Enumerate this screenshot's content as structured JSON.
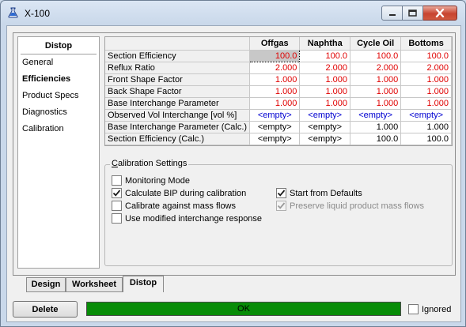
{
  "window": {
    "title": "X-100",
    "app_icon": "flask-icon",
    "controls": [
      "minimize-icon",
      "maximize-icon",
      "close-icon"
    ]
  },
  "nav": {
    "header": "Distop",
    "items": [
      "General",
      "Efficiencies",
      "Product Specs",
      "Diagnostics",
      "Calibration"
    ],
    "active": "Efficiencies"
  },
  "grid": {
    "columns": [
      "Offgas",
      "Naphtha",
      "Cycle Oil",
      "Bottoms"
    ],
    "rows": [
      {
        "label": "Section Efficiency",
        "values": [
          "100.0",
          "100.0",
          "100.0",
          "100.0"
        ],
        "style": "red"
      },
      {
        "label": "Reflux Ratio",
        "values": [
          "2.000",
          "2.000",
          "2.000",
          "2.000"
        ],
        "style": "red"
      },
      {
        "label": "Front Shape Factor",
        "values": [
          "1.000",
          "1.000",
          "1.000",
          "1.000"
        ],
        "style": "red"
      },
      {
        "label": "Back Shape Factor",
        "values": [
          "1.000",
          "1.000",
          "1.000",
          "1.000"
        ],
        "style": "red"
      },
      {
        "label": "Base Interchange Parameter",
        "values": [
          "1.000",
          "1.000",
          "1.000",
          "1.000"
        ],
        "style": "red"
      },
      {
        "label": "Observed Vol Interchange [vol %]",
        "values": [
          "<empty>",
          "<empty>",
          "<empty>",
          "<empty>"
        ],
        "style": "blue"
      },
      {
        "label": "Base Interchange Parameter (Calc.)",
        "values": [
          "<empty>",
          "<empty>",
          "1.000",
          "1.000"
        ],
        "style": "black"
      },
      {
        "label": "Section Efficiency (Calc.)",
        "values": [
          "<empty>",
          "<empty>",
          "100.0",
          "100.0"
        ],
        "style": "black"
      }
    ]
  },
  "calibration": {
    "title_prefix": "",
    "title_accel": "C",
    "title_rest": "alibration Settings",
    "options": {
      "monitoring_mode": {
        "label": "Monitoring Mode",
        "checked": false
      },
      "calculate_bip": {
        "label": "Calculate BIP during calibration",
        "checked": true
      },
      "calibrate_mass": {
        "label": "Calibrate against mass flows",
        "checked": false
      },
      "modified_interchange": {
        "label": "Use modified interchange response",
        "checked": false
      },
      "start_defaults": {
        "label": "Start from Defaults",
        "checked": true
      },
      "preserve_liquid": {
        "label": "Preserve liquid product mass flows",
        "checked": true,
        "disabled": true
      }
    }
  },
  "tabs": {
    "items": [
      "Design",
      "Worksheet",
      "Distop"
    ],
    "active": "Distop"
  },
  "footer": {
    "delete_label": "Delete",
    "status_text": "OK",
    "status_color": "#078c07",
    "ignored_label": "Ignored",
    "ignored_checked": false
  }
}
